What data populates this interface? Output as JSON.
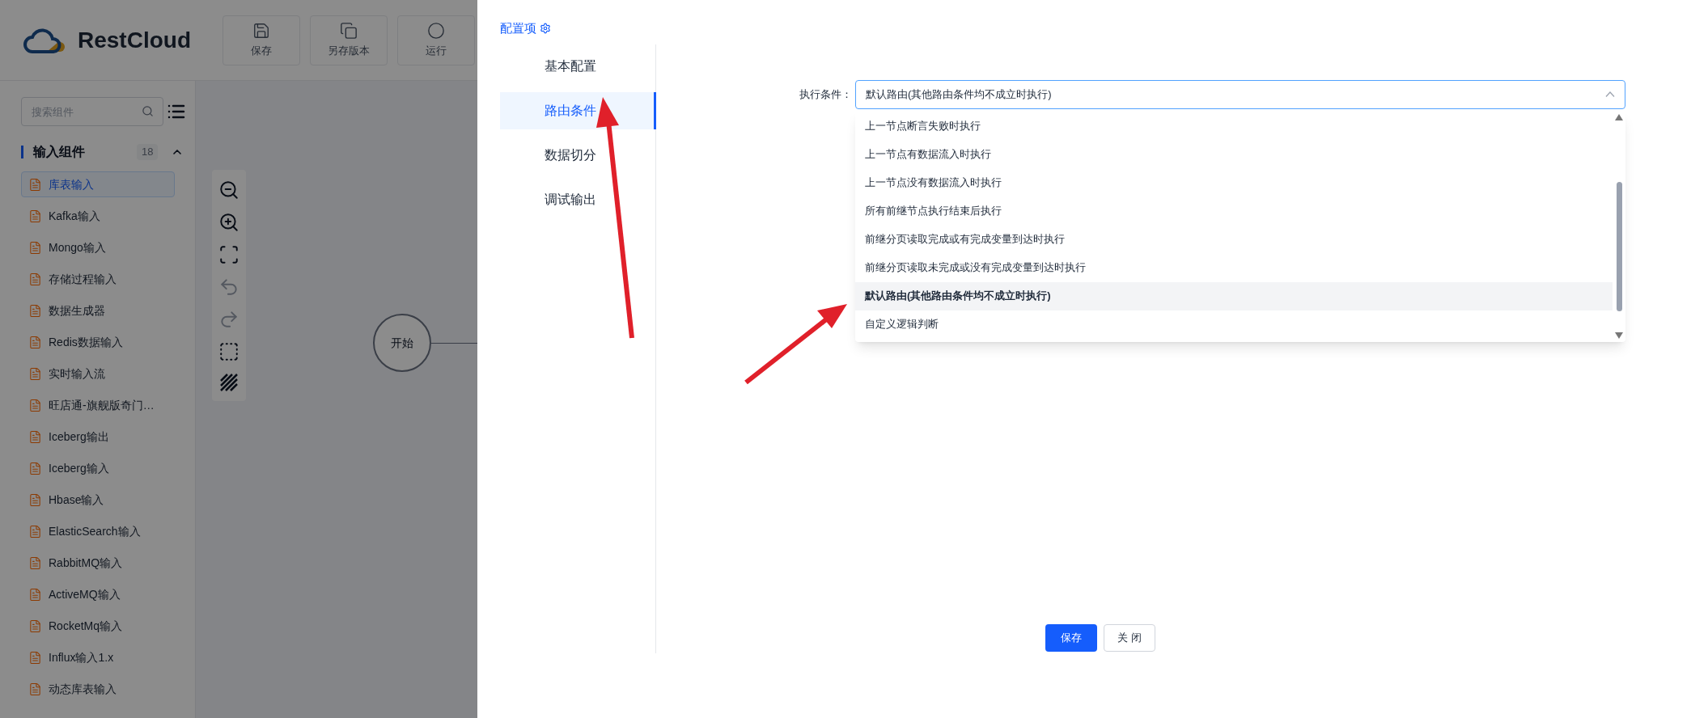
{
  "header": {
    "logo": "RestCloud",
    "toolbar": [
      {
        "kind": "save",
        "label": "保存"
      },
      {
        "kind": "versions",
        "label": "另存版本"
      },
      {
        "kind": "run",
        "label": "运行"
      }
    ]
  },
  "sidebar": {
    "search": {
      "placeholder": "搜索组件"
    },
    "section": {
      "title": "输入组件",
      "count": "18",
      "expanded": true
    },
    "items": [
      {
        "label": "库表输入",
        "selected": true
      },
      {
        "label": "Kafka输入",
        "selected": false
      },
      {
        "label": "Mongo输入",
        "selected": false
      },
      {
        "label": "存储过程输入",
        "selected": false
      },
      {
        "label": "数据生成器",
        "selected": false
      },
      {
        "label": "Redis数据输入",
        "selected": false
      },
      {
        "label": "实时输入流",
        "selected": false
      },
      {
        "label": "旺店通-旗舰版奇门…",
        "selected": false
      },
      {
        "label": "Iceberg输出",
        "selected": false
      },
      {
        "label": "Iceberg输入",
        "selected": false
      },
      {
        "label": "Hbase输入",
        "selected": false
      },
      {
        "label": "ElasticSearch输入",
        "selected": false
      },
      {
        "label": "RabbitMQ输入",
        "selected": false
      },
      {
        "label": "ActiveMQ输入",
        "selected": false
      },
      {
        "label": "RocketMq输入",
        "selected": false
      },
      {
        "label": "Influx输入1.x",
        "selected": false
      },
      {
        "label": "动态库表输入",
        "selected": false
      }
    ]
  },
  "canvas": {
    "tools": [
      {
        "kind": "zoom-out",
        "disabled": false
      },
      {
        "kind": "zoom-in",
        "disabled": false
      },
      {
        "kind": "fit",
        "disabled": false
      },
      {
        "kind": "undo",
        "disabled": true
      },
      {
        "kind": "redo",
        "disabled": true
      },
      {
        "kind": "frame",
        "disabled": false
      },
      {
        "kind": "hatch",
        "disabled": false
      }
    ],
    "node": {
      "label": "开始"
    }
  },
  "drawer": {
    "title": "配置项",
    "menu": [
      {
        "label": "基本配置",
        "selected": false
      },
      {
        "label": "路由条件",
        "selected": true
      },
      {
        "label": "数据切分",
        "selected": false
      },
      {
        "label": "调试输出",
        "selected": false
      }
    ],
    "field": {
      "label": "执行条件：",
      "value": "默认路由(其他路由条件均不成立时执行)",
      "expanded": true
    },
    "options": [
      {
        "label": "上一节点断言失败时执行",
        "selected": false
      },
      {
        "label": "上一节点有数据流入时执行",
        "selected": false
      },
      {
        "label": "上一节点没有数据流入时执行",
        "selected": false
      },
      {
        "label": "所有前继节点执行结束后执行",
        "selected": false
      },
      {
        "label": "前继分页读取完成或有完成变量到达时执行",
        "selected": false
      },
      {
        "label": "前继分页读取未完成或没有完成变量到达时执行",
        "selected": false
      },
      {
        "label": "默认路由(其他路由条件均不成立时执行)",
        "selected": true
      },
      {
        "label": "自定义逻辑判断",
        "selected": false
      }
    ],
    "buttons": [
      {
        "kind": "primary",
        "label": "保存"
      },
      {
        "kind": "default",
        "label": "关 闭"
      }
    ]
  }
}
